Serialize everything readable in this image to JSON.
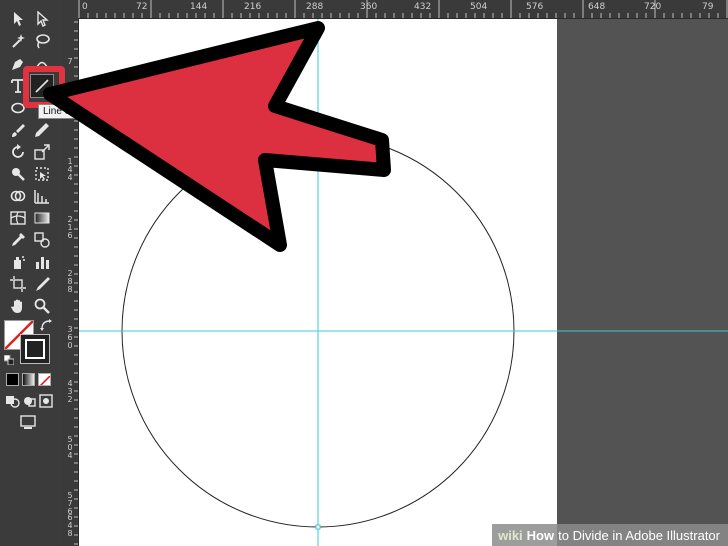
{
  "rulers": {
    "top_labels": [
      "0",
      "72",
      "144",
      "216",
      "288",
      "360",
      "432",
      "504",
      "576",
      "648",
      "720",
      "79"
    ],
    "left_labels": [
      "7",
      "1 4 4",
      "2 1 6",
      "2 8 8",
      "3 6 0",
      "4 3 2",
      "5 0 4",
      "5 7 6",
      "6 4 8"
    ]
  },
  "tooltip": {
    "text": "Line S"
  },
  "watermark": {
    "brand": "wiki",
    "how": "How",
    "title": " to Divide in Adobe Illustrator"
  },
  "colors": {
    "arrow": "#dc3040",
    "highlight": "#e0323f",
    "guide": "#3fc8d8",
    "panel": "#3b3b3b",
    "pasteboard": "#535353"
  },
  "icons": [
    "selection-tool-icon",
    "direct-selection-tool-icon",
    "magic-wand-icon",
    "lasso-icon",
    "pen-tool-icon",
    "curvature-tool-icon",
    "type-tool-icon",
    "line-segment-tool-icon",
    "ellipse-tool-icon",
    "paintbrush-icon",
    "pencil-icon",
    "rotate-tool-icon",
    "scale-tool-icon",
    "warp-tool-icon",
    "free-transform-icon",
    "shape-builder-icon",
    "perspective-grid-icon",
    "mesh-tool-icon",
    "gradient-tool-icon",
    "eyedropper-icon",
    "blend-tool-icon",
    "symbol-sprayer-icon",
    "column-graph-icon",
    "artboard-tool-icon",
    "slice-tool-icon",
    "hand-tool-icon",
    "zoom-tool-icon",
    "swap-fill-stroke-icon",
    "default-fill-stroke-icon",
    "fill-swatch-icon",
    "stroke-swatch-icon",
    "color-mode-icon",
    "gradient-mode-icon",
    "none-mode-icon",
    "draw-normal-icon",
    "draw-behind-icon",
    "draw-inside-icon",
    "screen-mode-icon"
  ]
}
